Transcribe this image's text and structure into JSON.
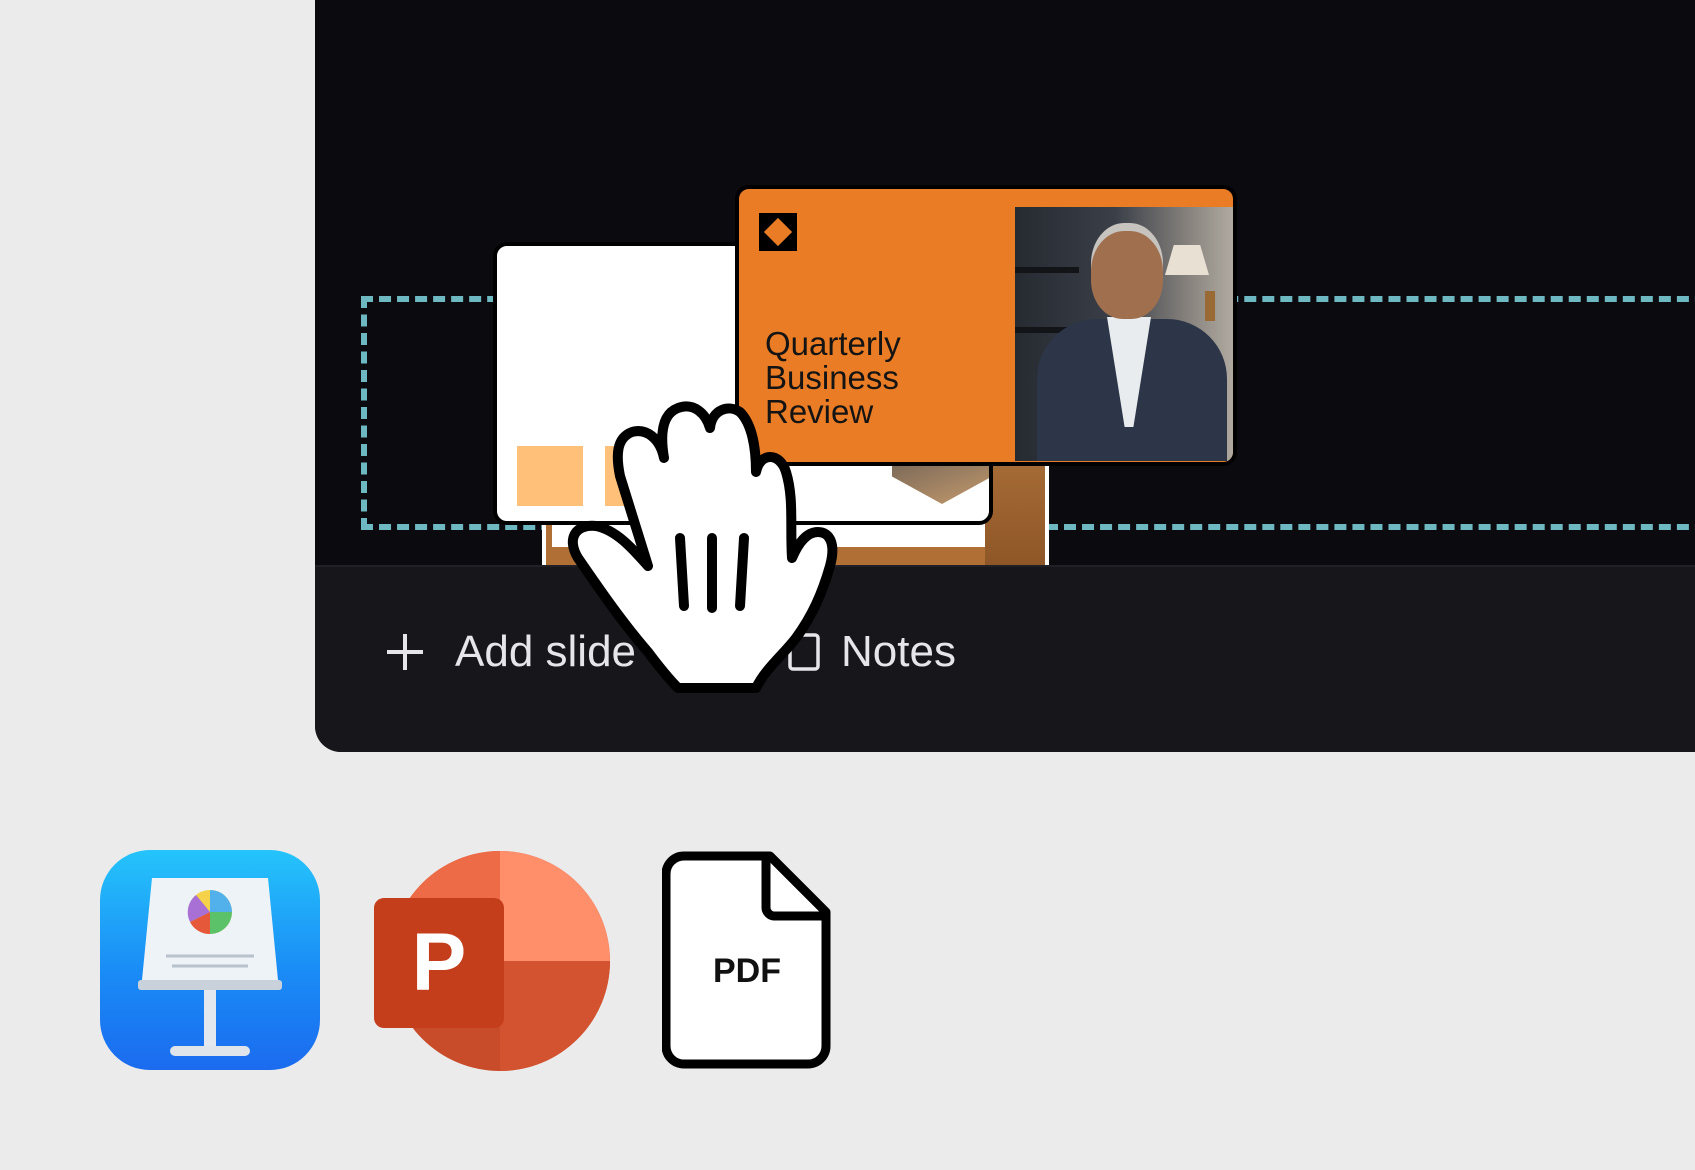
{
  "editor": {
    "slide_title": "Quarterly Business Review",
    "slide_title_lines": [
      "Quarterly",
      "Business",
      "Review"
    ]
  },
  "bottom_bar": {
    "add_slide_label": "Add slide",
    "notes_label": "Notes"
  },
  "formats": {
    "pdf_label": "PDF",
    "items": [
      "keynote-icon",
      "powerpoint-icon",
      "pdf-file-icon"
    ]
  },
  "colors": {
    "accent_orange": "#e97c24",
    "drop_zone": "#6eb8c2",
    "editor_bg": "#0b0b0f"
  }
}
